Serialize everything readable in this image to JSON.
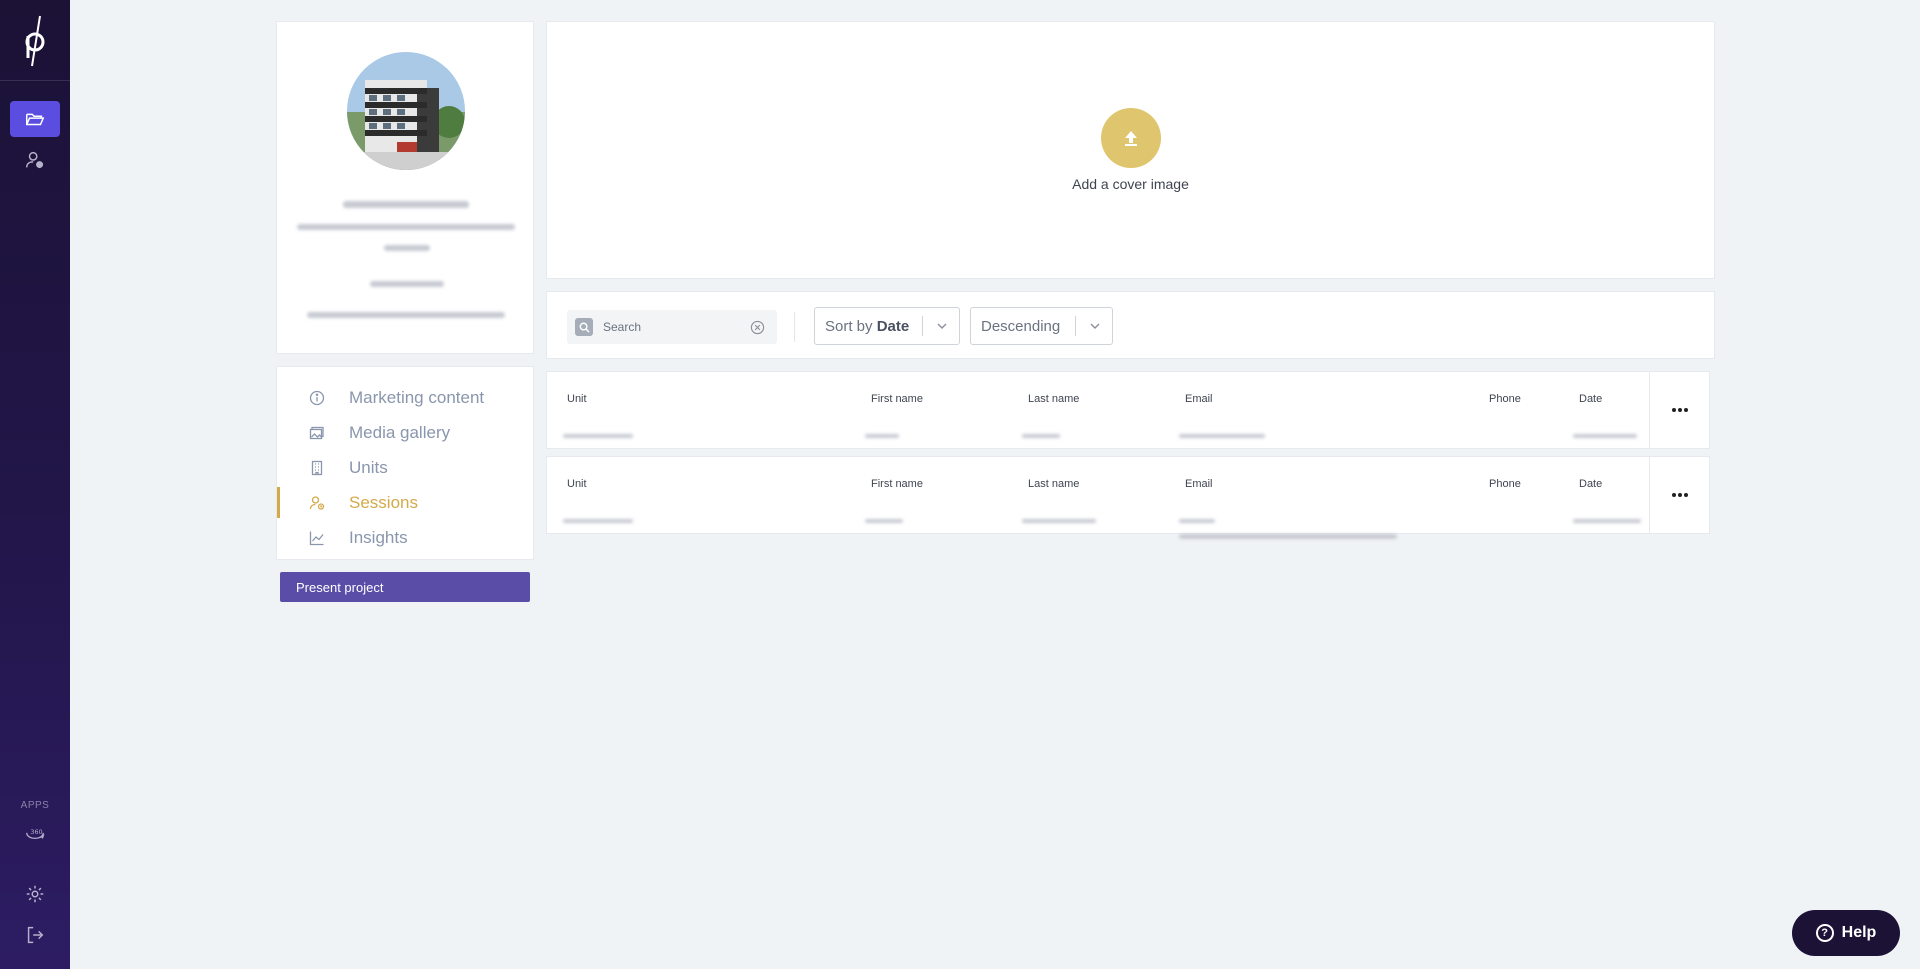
{
  "sidebar": {
    "apps_label": "APPS",
    "icons": [
      "projects-folder-icon",
      "users-icon",
      "360-view-icon",
      "settings-icon",
      "logout-icon"
    ],
    "accent": "#5a4de0"
  },
  "cover": {
    "label": "Add a cover image",
    "accent": "#dfc56d"
  },
  "nav": {
    "items": [
      {
        "label": "Marketing content",
        "icon": "info-icon"
      },
      {
        "label": "Media gallery",
        "icon": "gallery-icon"
      },
      {
        "label": "Units",
        "icon": "building-icon"
      },
      {
        "label": "Sessions",
        "icon": "user-session-icon",
        "active": true
      },
      {
        "label": "Insights",
        "icon": "chart-icon"
      }
    ],
    "active_color": "#d4a94a"
  },
  "present_button": {
    "label": "Present project"
  },
  "toolbar": {
    "search_placeholder": "Search",
    "sort_prefix": "Sort by",
    "sort_value": "Date",
    "order_value": "Descending"
  },
  "table": {
    "headers": [
      "Unit",
      "First name",
      "Last name",
      "Email",
      "Phone",
      "Date"
    ]
  },
  "help": {
    "label": "Help"
  }
}
